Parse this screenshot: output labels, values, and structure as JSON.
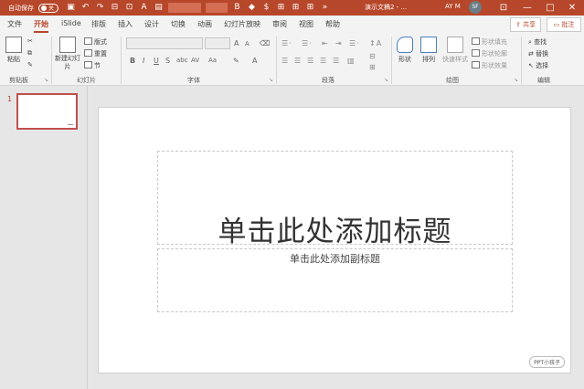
{
  "titlebar": {
    "autosave_label": "自动保存",
    "autosave_state": "关",
    "doc_title": "演示文稿2 - ...",
    "user": "AY M",
    "avatar_initials": "SF",
    "controls": [
      "—",
      "□",
      "✕"
    ],
    "accent_color": "#b7472a"
  },
  "tabs": [
    {
      "label": "文件"
    },
    {
      "label": "开始",
      "active": true
    },
    {
      "label": "iSlide"
    },
    {
      "label": "排版"
    },
    {
      "label": "插入"
    },
    {
      "label": "设计"
    },
    {
      "label": "切换"
    },
    {
      "label": "动画"
    },
    {
      "label": "幻灯片放映"
    },
    {
      "label": "审阅"
    },
    {
      "label": "视图"
    },
    {
      "label": "帮助"
    }
  ],
  "share_label": "共享",
  "comment_label": "批注",
  "ribbon": {
    "clipboard": {
      "label": "剪贴板",
      "paste": "粘贴"
    },
    "slides": {
      "label": "幻灯片",
      "new_slide": "新建幻灯片",
      "layout": "版式",
      "reset": "重置",
      "section": "节"
    },
    "font": {
      "label": "字体",
      "bold": "B",
      "italic": "I",
      "underline": "U",
      "strike": "S",
      "shadow": "abc",
      "spacing": "AV",
      "case": "Aa",
      "grow": "A",
      "shrink": "A"
    },
    "paragraph": {
      "label": "段落"
    },
    "drawing": {
      "label": "绘图",
      "shapes": "形状",
      "arrange": "排列",
      "quick_styles": "快速样式",
      "fill": "形状填充",
      "outline": "形状轮廓",
      "effects": "形状效果"
    },
    "editing": {
      "label": "编辑",
      "find": "查找",
      "replace": "替换",
      "select": "选择"
    }
  },
  "thumbnails": [
    {
      "number": "1"
    }
  ],
  "slide": {
    "title_placeholder": "单击此处添加标题",
    "subtitle_placeholder": "单击此处添加副标题",
    "watermark": "PPT小孩子"
  }
}
